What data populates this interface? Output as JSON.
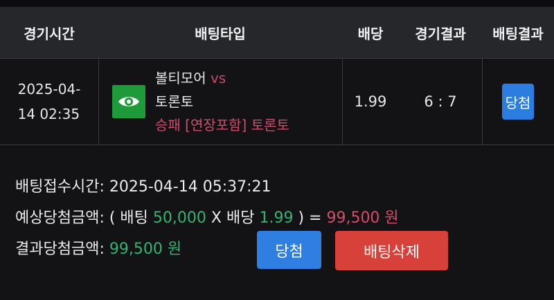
{
  "header": {
    "col_time": "경기시간",
    "col_type": "배팅타입",
    "col_odds": "배당",
    "col_result": "경기결과",
    "col_bet_result": "배팅결과"
  },
  "bet_row": {
    "time_date": "2025-04-",
    "time_rest": "14 02:35",
    "home_team": "볼티모어",
    "vs": "vs",
    "away_team": "토론토",
    "bet_type": "승패 [연장포함] 토론토",
    "odds": "1.99",
    "score": "6 : 7",
    "bet_result": "당첨"
  },
  "details": {
    "received_label": "배팅접수시간:",
    "received_value": "2025-04-14 05:37:21",
    "expected_label": "예상당첨금액:",
    "expected_open": "( 배팅",
    "stake": "50,000",
    "times": "X 배당",
    "odds": "1.99",
    "expected_close": ") =",
    "expected_amount": "99,500 원",
    "result_label": "결과당첨금액:",
    "result_amount": "99,500 원"
  },
  "buttons": {
    "win": "당첨",
    "delete": "배팅삭제"
  },
  "colors": {
    "header_bg": "#26272b",
    "page_bg": "#131316",
    "accent_green": "#33b56f",
    "accent_pink": "#d84b6a",
    "button_blue": "#2f7fe2",
    "button_red": "#d8403a",
    "eye_icon_bg": "#1f9a3a"
  },
  "icons": {
    "game_icon": "eye-icon"
  }
}
